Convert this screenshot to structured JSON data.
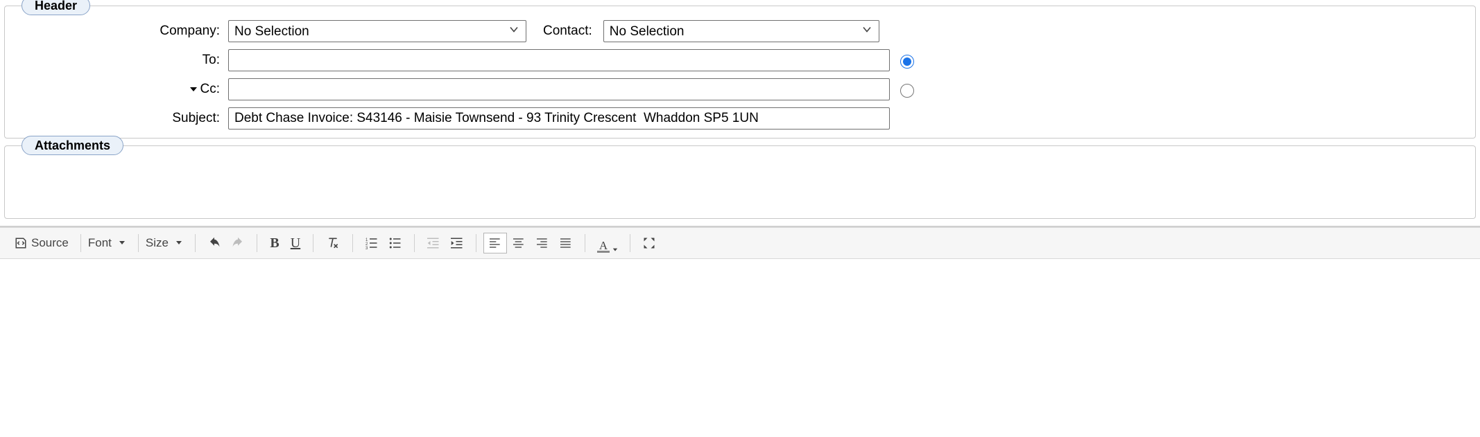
{
  "header": {
    "legend": "Header",
    "company_label": "Company:",
    "company_value": "No Selection",
    "contact_label": "Contact:",
    "contact_value": "No Selection",
    "to_label": "To:",
    "to_value": "",
    "cc_label": "Cc:",
    "cc_value": "",
    "subject_label": "Subject:",
    "subject_value": "Debt Chase Invoice: S43146 - Maisie Townsend - 93 Trinity Crescent  Whaddon SP5 1UN",
    "recipient_mode_to_selected": true,
    "recipient_mode_cc_selected": false
  },
  "attachments": {
    "legend": "Attachments"
  },
  "toolbar": {
    "source_label": "Source",
    "font_label": "Font",
    "size_label": "Size"
  }
}
